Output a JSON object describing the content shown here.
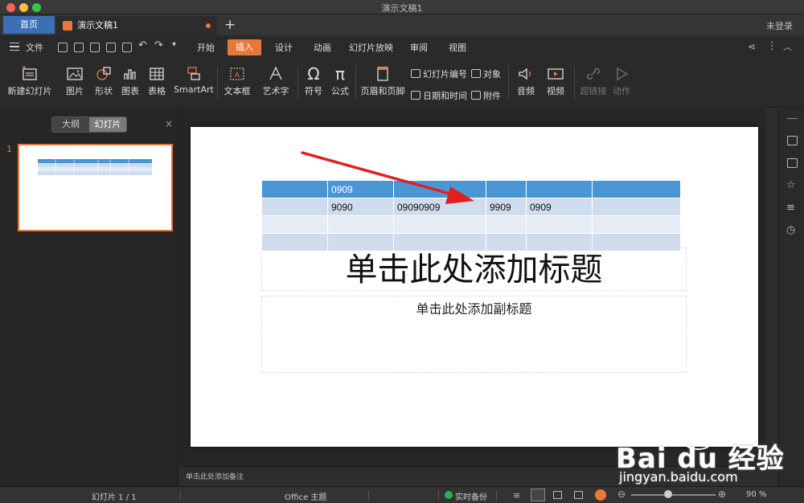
{
  "window": {
    "title": "演示文稿1"
  },
  "tabs": {
    "home": "首页",
    "doc": "演示文稿1",
    "new": "+",
    "login": "未登录"
  },
  "menu": {
    "file": "文件",
    "items": [
      "开始",
      "插入",
      "设计",
      "动画",
      "幻灯片放映",
      "审阅",
      "视图"
    ],
    "active": "插入"
  },
  "ribbon": {
    "new_slide": "新建幻灯片",
    "picture": "图片",
    "shape": "形状",
    "chart": "图表",
    "table": "表格",
    "smartart": "SmartArt",
    "textbox": "文本框",
    "wordart": "艺术字",
    "symbol": "符号",
    "formula": "公式",
    "header_footer": "页眉和页脚",
    "slide_number": "幻灯片编号",
    "object": "对象",
    "datetime": "日期和时间",
    "attachment": "附件",
    "audio": "音频",
    "video": "视频",
    "hyperlink": "超链接",
    "action": "动作"
  },
  "left_panel": {
    "outline_tab": "大纲",
    "slides_tab": "幻灯片",
    "close": "×",
    "thumb_number": "1"
  },
  "slide": {
    "table": {
      "header": [
        "",
        "0909",
        "",
        "",
        "",
        ""
      ],
      "rows": [
        [
          "",
          "9090",
          "09090909",
          "9909",
          "0909",
          ""
        ],
        [
          "",
          "",
          "",
          "",
          "",
          ""
        ],
        [
          "",
          "",
          "",
          "",
          "",
          ""
        ]
      ]
    },
    "title_placeholder": "单击此处添加标题",
    "subtitle_placeholder": "单击此处添加副标题"
  },
  "notes_placeholder": "单击此处添加备注",
  "status": {
    "slide_counter": "幻灯片 1 / 1",
    "theme": "Office 主题",
    "backup": "实时备份",
    "zoom": "90 %"
  },
  "watermark": {
    "brand": "Bai du 经验",
    "url": "jingyan.baidu.com"
  },
  "colors": {
    "accent": "#e8773a",
    "table_header": "#4a96d4",
    "arrow": "#e02020"
  }
}
